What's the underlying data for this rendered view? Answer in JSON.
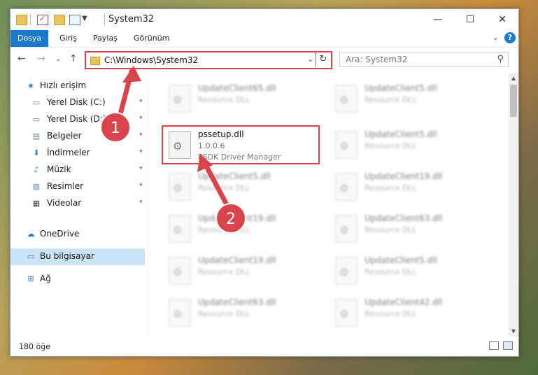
{
  "window": {
    "title": "System32",
    "controls": {
      "minimize": "—",
      "maximize": "☐",
      "close": "✕"
    }
  },
  "ribbon": {
    "tabs": [
      {
        "label": "Dosya",
        "active": true
      },
      {
        "label": "Giriş",
        "active": false
      },
      {
        "label": "Paylaş",
        "active": false
      },
      {
        "label": "Görünüm",
        "active": false
      }
    ],
    "expand_glyph": "⌄",
    "help_glyph": "?"
  },
  "nav": {
    "back": "←",
    "forward": "→",
    "recent": "⌄",
    "up": "↑",
    "address": "C:\\Windows\\System32",
    "address_dropdown": "⌄",
    "refresh": "↻",
    "search_placeholder": "Ara: System32",
    "search_icon": "⚲"
  },
  "sidebar": {
    "items": [
      {
        "label": "Hızlı erişim",
        "icon": "star-icon",
        "glyph": "★",
        "pinned": false
      },
      {
        "label": "Yerel Disk (C:)",
        "icon": "drive-icon",
        "glyph": "▭",
        "pinned": true
      },
      {
        "label": "Yerel Disk (D:)",
        "icon": "drive-icon",
        "glyph": "▭",
        "pinned": true
      },
      {
        "label": "Belgeler",
        "icon": "documents-icon",
        "glyph": "▤",
        "pinned": true
      },
      {
        "label": "İndirmeler",
        "icon": "downloads-icon",
        "glyph": "⬇",
        "pinned": true
      },
      {
        "label": "Müzik",
        "icon": "music-icon",
        "glyph": "♪",
        "pinned": true
      },
      {
        "label": "Resimler",
        "icon": "pictures-icon",
        "glyph": "▨",
        "pinned": true
      },
      {
        "label": "Videolar",
        "icon": "videos-icon",
        "glyph": "▦",
        "pinned": true
      },
      {
        "label": "OneDrive",
        "icon": "cloud-icon",
        "glyph": "☁",
        "pinned": false
      },
      {
        "label": "Bu bilgisayar",
        "icon": "computer-icon",
        "glyph": "▭",
        "pinned": false,
        "selected": true
      },
      {
        "label": "Ağ",
        "icon": "network-icon",
        "glyph": "⊞",
        "pinned": false
      }
    ],
    "pin_glyph": "✦"
  },
  "files": {
    "left": [
      {
        "name": "UpdateClient65.dll",
        "desc": "Resource DLL",
        "blurred": true
      },
      {
        "name": "pssetup.dll",
        "version": "1.0.0.6",
        "desc": "PSDK Driver Manager",
        "blurred": false,
        "highlighted": true
      },
      {
        "name": "UpdateClient5.dll",
        "desc": "Resource DLL",
        "blurred": true
      },
      {
        "name": "UpdateClient19.dll",
        "desc": "Resource DLL",
        "blurred": true
      },
      {
        "name": "UpdateClient19.dll",
        "desc": "Resource DLL",
        "blurred": true
      },
      {
        "name": "UpdateClient63.dll",
        "desc": "Resource DLL",
        "blurred": true
      }
    ],
    "right": [
      {
        "name": "UpdateClient5.dll",
        "desc": "Resource DLL",
        "blurred": true
      },
      {
        "name": "UpdateClient5.dll",
        "desc": "Resource DLL",
        "blurred": true
      },
      {
        "name": "UpdateClient19.dll",
        "desc": "Resource DLL",
        "blurred": true
      },
      {
        "name": "UpdateClient63.dll",
        "desc": "Resource DLL",
        "blurred": true
      },
      {
        "name": "UpdateClient5.dll",
        "desc": "Resource DLL",
        "blurred": true
      },
      {
        "name": "UpdateClient42.dll",
        "desc": "Resource DLL",
        "blurred": true
      }
    ],
    "gear_glyph": "⚙"
  },
  "status": {
    "item_count": "180 öğe"
  },
  "annotations": {
    "badges": [
      {
        "label": "1"
      },
      {
        "label": "2"
      }
    ],
    "accent_color": "#d9434b"
  },
  "colors": {
    "active_tab": "#1979ca",
    "selection": "#cce4f7",
    "annotation_red": "#d9434b",
    "folder_yellow": "#e9c45a"
  }
}
